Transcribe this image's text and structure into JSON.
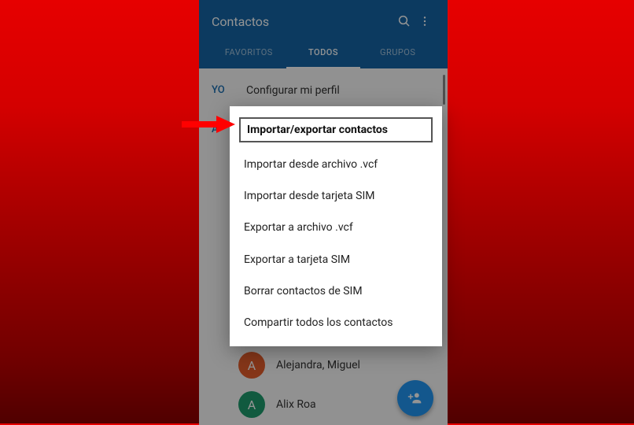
{
  "appbar": {
    "title": "Contactos",
    "search_icon": "search-icon",
    "more_icon": "more-icon"
  },
  "tabs": {
    "fav": "FAVORITOS",
    "all": "TODOS",
    "groups": "GRUPOS"
  },
  "profile": {
    "label": "YO",
    "text": "Configurar mi perfil"
  },
  "section_a": "A",
  "contacts": [
    {
      "initial": "A",
      "name": "Alejandra, Mig",
      "color": "#e55d2b"
    },
    {
      "initial": "A",
      "name": "Alejandra, Miguel",
      "color": "#e55d2b"
    },
    {
      "initial": "A",
      "name": "Alix Roa",
      "color": "#1e9b6d"
    }
  ],
  "menu": {
    "title": "Importar/exportar contactos",
    "items": [
      "Importar desde archivo .vcf",
      "Importar desde tarjeta SIM",
      "Exportar a archivo .vcf",
      "Exportar a tarjeta SIM",
      "Borrar contactos de SIM",
      "Compartir todos los contactos"
    ]
  },
  "fab_icon": "add-contact-icon"
}
